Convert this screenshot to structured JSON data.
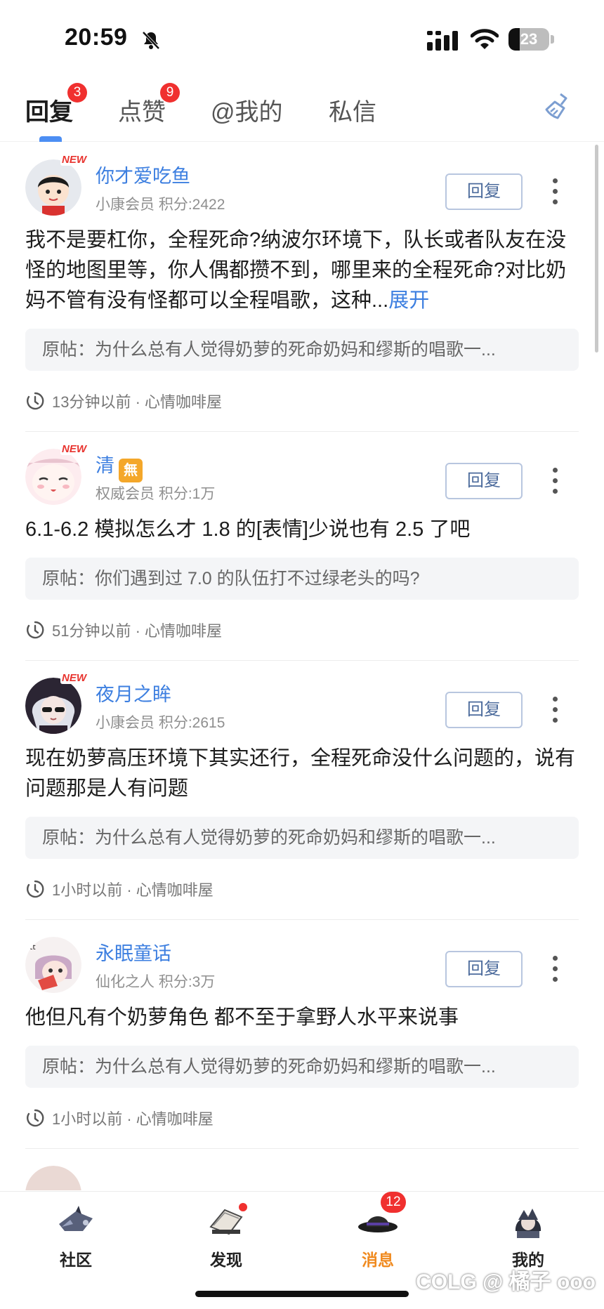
{
  "status_bar": {
    "time": "20:59",
    "battery": "23"
  },
  "tabs": [
    {
      "label": "回复",
      "badge": "3"
    },
    {
      "label": "点赞",
      "badge": "9"
    },
    {
      "label": "@我的"
    },
    {
      "label": "私信"
    }
  ],
  "comments": [
    {
      "name": "你才爱吃鱼",
      "new_tag": "NEW",
      "meta": "小康会员 积分:2422",
      "reply_label": "回复",
      "content": "我不是要杠你，全程死命?纳波尔环境下，队长或者队友在没怪的地图里等，你人偶都攒不到，哪里来的全程死命?对比奶妈不管有没有怪都可以全程唱歌，这种...",
      "expand": "展开",
      "origin": "原帖：为什么总有人觉得奶萝的死命奶妈和缪斯的唱歌一...",
      "footer": "13分钟以前 · 心情咖啡屋"
    },
    {
      "name": "清",
      "new_tag": "NEW",
      "vip": "無",
      "meta": "权威会员 积分:1万",
      "reply_label": "回复",
      "content": "6.1-6.2 模拟怎么才 1.8 的[表情]少说也有 2.5 了吧",
      "origin": "原帖：你们遇到过 7.0 的队伍打不过绿老头的吗?",
      "footer": "51分钟以前 · 心情咖啡屋"
    },
    {
      "name": "夜月之眸",
      "new_tag": "NEW",
      "meta": "小康会员 积分:2615",
      "reply_label": "回复",
      "content": "现在奶萝高压环境下其实还行，全程死命没什么问题的，说有问题那是人有问题",
      "origin": "原帖：为什么总有人觉得奶萝的死命奶妈和缪斯的唱歌一...",
      "footer": "1小时以前 · 心情咖啡屋"
    },
    {
      "name": "永眠童话",
      "meta": "仙化之人 积分:3万",
      "reply_label": "回复",
      "content": "他但凡有个奶萝角色 都不至于拿野人水平来说事",
      "origin": "原帖：为什么总有人觉得奶萝的死命奶妈和缪斯的唱歌一...",
      "footer": "1小时以前 · 心情咖啡屋"
    }
  ],
  "bottom_nav": [
    {
      "label": "社区"
    },
    {
      "label": "发现"
    },
    {
      "label": "消息",
      "badge": "12"
    },
    {
      "label": "我的"
    }
  ],
  "watermark": "COLG @ 橘子 ooo",
  "colors": {
    "accent": "#3d7fe0",
    "badge": "#f0302f",
    "active_nav": "#f08a1f"
  }
}
